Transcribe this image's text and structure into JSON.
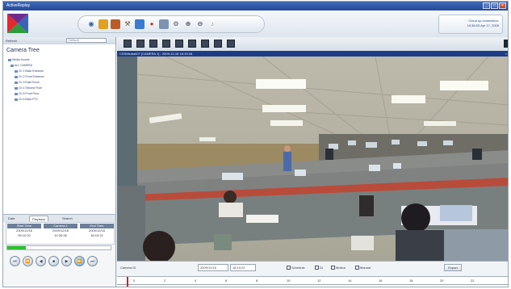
{
  "window": {
    "title": "ActiveReplay",
    "buttons": [
      "_",
      "□",
      "×"
    ]
  },
  "header": {
    "logo": "activereplay-logo",
    "toolbar_icons": [
      "eye-icon",
      "camera-icon",
      "grid-icon",
      "tools-icon",
      "screen-icon",
      "record-icon",
      "snapshot-icon",
      "settings-icon",
      "zoom-in-icon",
      "zoom-out-icon",
      "audio-icon"
    ],
    "date_line1": "Cloud up connection:",
    "date_line2": "19:38:53 Apr 17, 2009"
  },
  "left": {
    "toolbar_label": "Refresh",
    "dropdown": "Default",
    "tree_title": "Camera Tree",
    "nodes": [
      "Media Source",
      "ALL CAMERA",
      "Ch 1 Back Entrance",
      "Ch 2 Front Entrance",
      "Ch 3 East Room",
      "Ch 4 Second Floor",
      "Ch 5 Front Floor",
      "Ch 6 Back PTZ"
    ],
    "tabs": [
      "Date",
      "Playback",
      "Search"
    ],
    "table_headers": [
      "Start Time",
      "Camera 1",
      "End Time"
    ],
    "table_row1": [
      "2009/12/16",
      "2009/12/16",
      "2009/12/16"
    ],
    "table_row2": [
      "09:10:20",
      "10:30:26",
      "18:19:22"
    ],
    "progress": 0.18,
    "controls": [
      "⏮",
      "⏪",
      "◀",
      "■",
      "▶",
      "⏩",
      "⏭"
    ]
  },
  "view": {
    "title": "CSSMedia007 [CAMERA 1] - 2009-12-16 18:19:28",
    "close": "×"
  },
  "bottom": {
    "label": "Camera ID",
    "date": "2009/12/16",
    "time": "18:19:22",
    "checks": [
      "Schedule",
      "Di",
      "Motion",
      "Manual"
    ],
    "button": "Export"
  },
  "timeline": {
    "ticks": [
      "0",
      "2",
      "4",
      "6",
      "8",
      "10",
      "12",
      "14",
      "16",
      "18",
      "20",
      "22"
    ]
  }
}
